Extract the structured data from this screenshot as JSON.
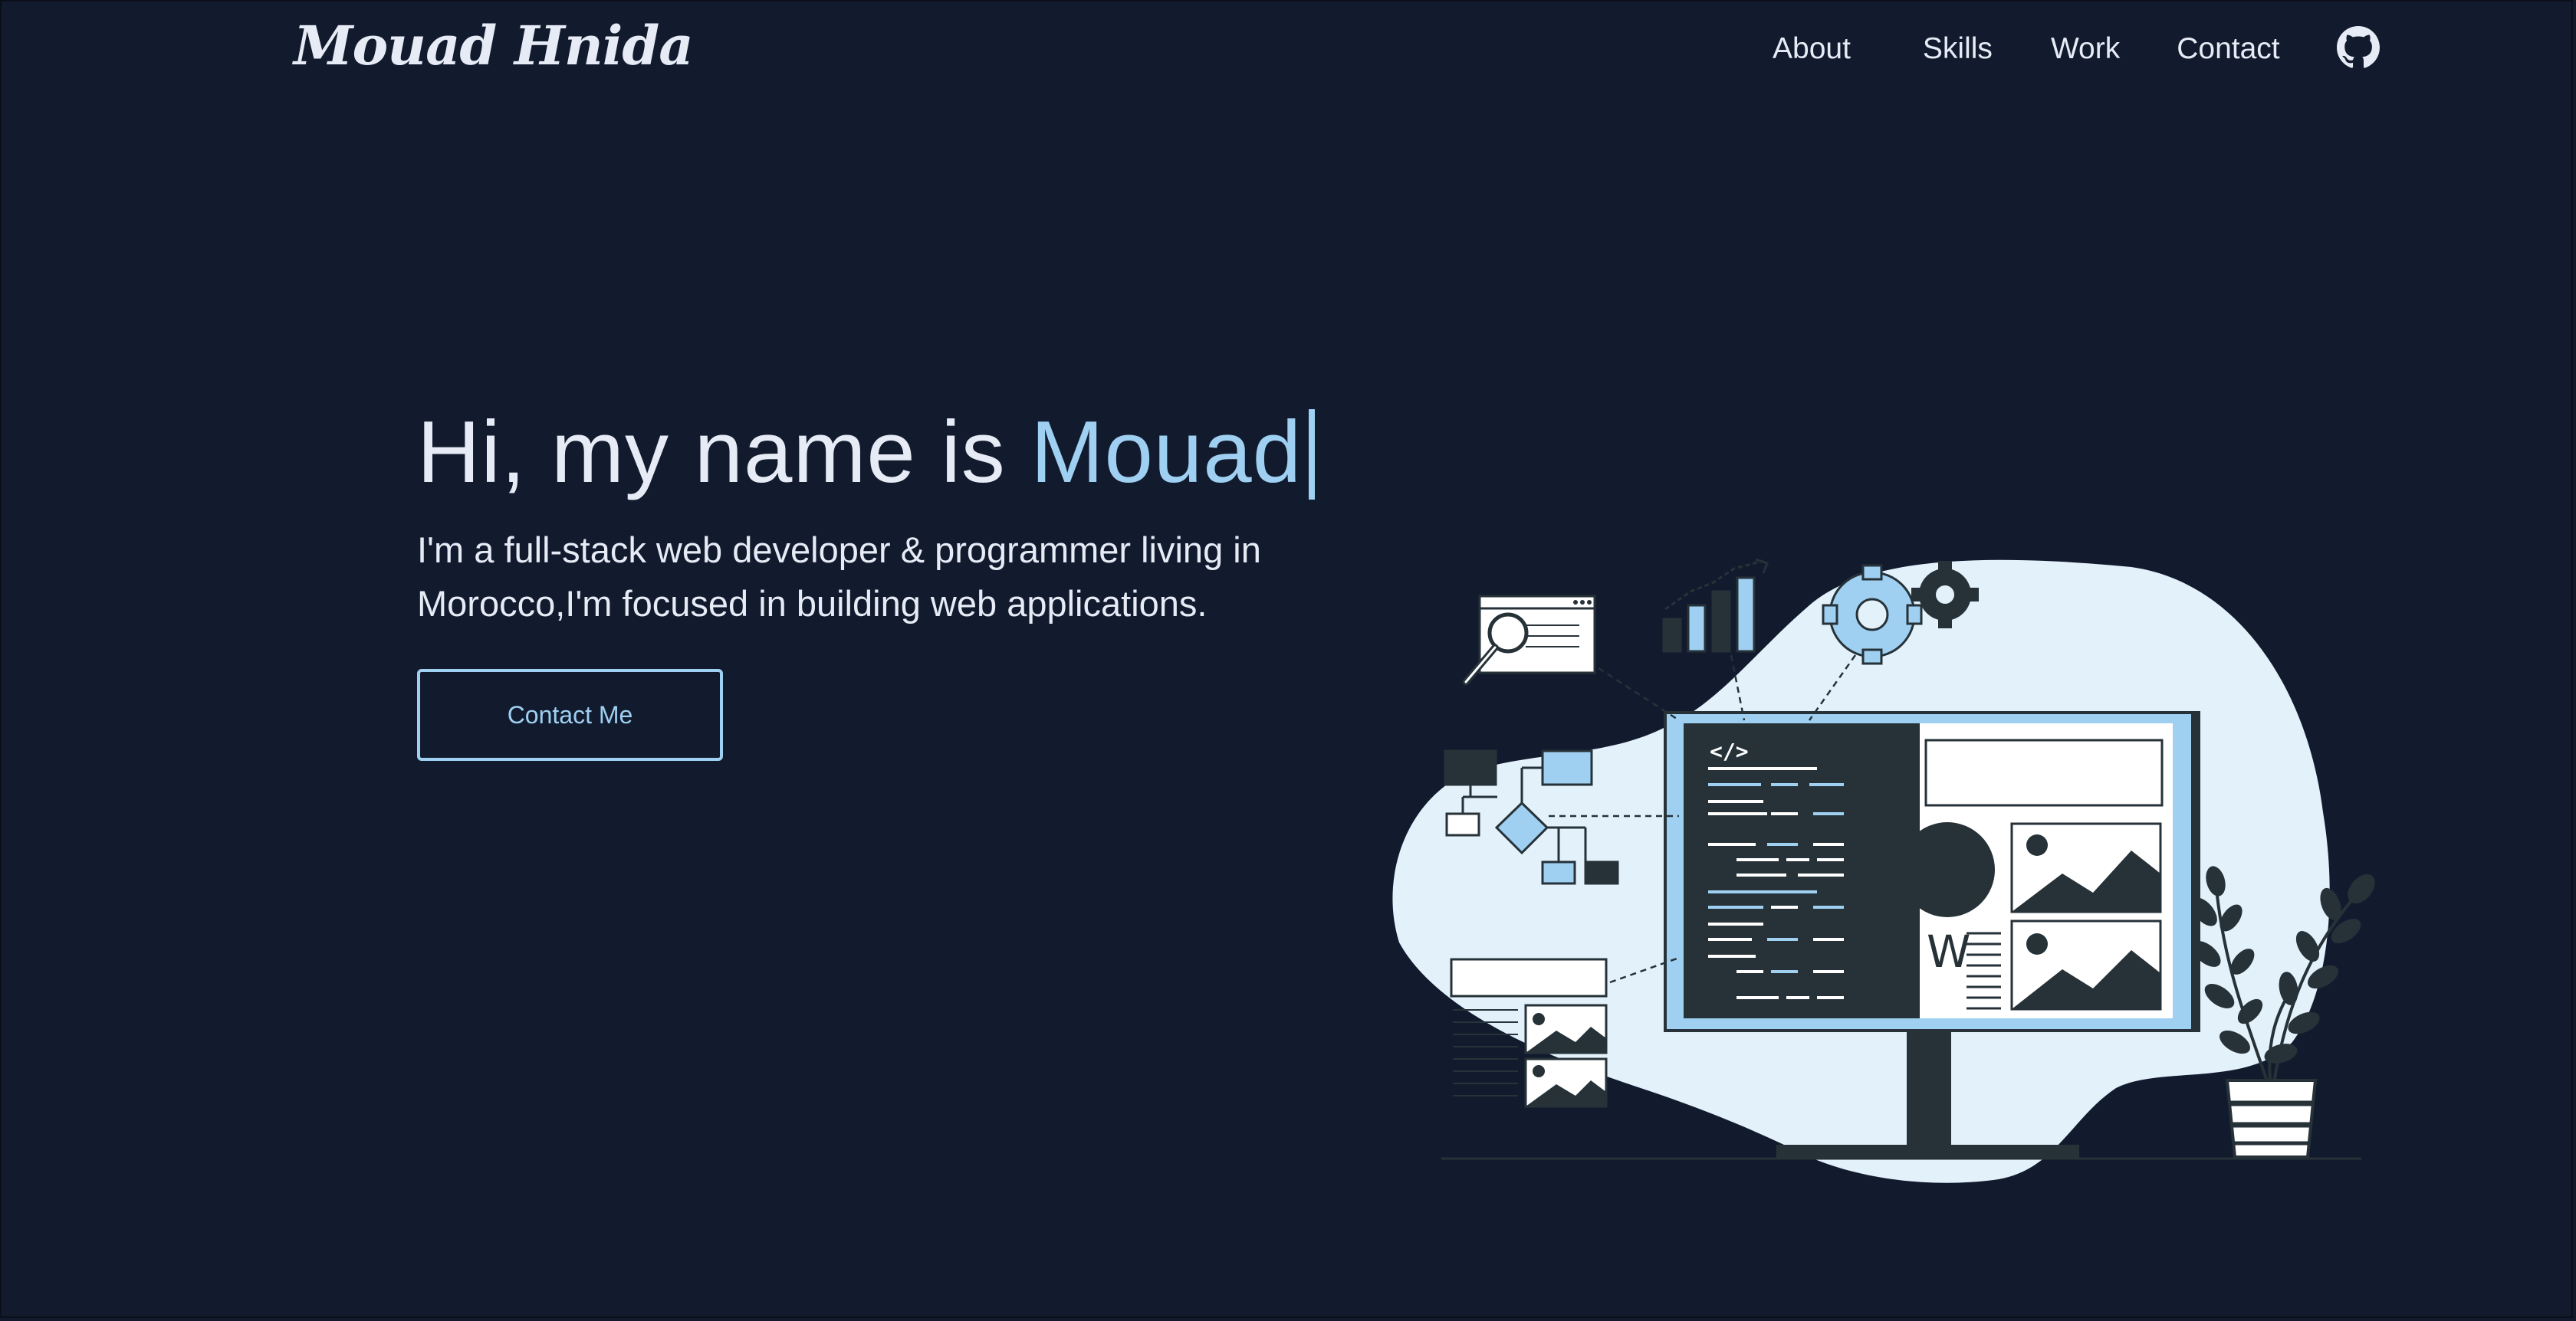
{
  "nav": {
    "logo": "Mouad Hnida",
    "links": [
      {
        "label": "About"
      },
      {
        "label": "Skills"
      },
      {
        "label": "Work"
      },
      {
        "label": "Contact"
      }
    ],
    "github_icon": "github-icon"
  },
  "hero": {
    "greeting": "Hi, my name is ",
    "name": "Mouad",
    "subtitle": "I'm a full-stack web developer & programmer living in Morocco,I'm focused in building web applications.",
    "cta_label": "Contact Me"
  },
  "illustration": {
    "code_tag": "</>",
    "w_letter": "W"
  },
  "colors": {
    "background": "#121b2e",
    "text": "#e6ebf5",
    "accent": "#9fd0f2",
    "blob": "#e3f1fb",
    "dark": "#263238"
  }
}
